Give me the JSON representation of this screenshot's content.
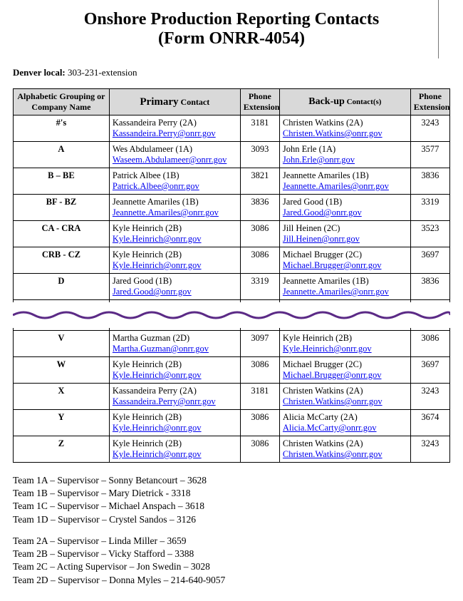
{
  "title_line1": "Onshore Production Reporting Contacts",
  "title_line2": "(Form ONRR-4054)",
  "denver_label": "Denver local:",
  "denver_value": "303-231-extension",
  "headers": {
    "group": "Alphabetic Grouping or Company Name",
    "primary_big": "Primary",
    "primary_sm": " Contact",
    "ext": "Phone Extension",
    "backup_big": "Back-up",
    "backup_sm": " Contact(s)"
  },
  "rows_top": [
    {
      "g": "#'s",
      "p_name": "Kassandeira Perry (2A)",
      "p_mail": "Kassandeira.Perry@onrr.gov",
      "p_ext": "3181",
      "b_name": "Christen Watkins (2A)",
      "b_mail": "Christen.Watkins@onrr.gov",
      "b_ext": "3243"
    },
    {
      "g": "A",
      "p_name": "Wes Abdulameer (1A)",
      "p_mail": "Waseem.Abdulameer@onrr.gov",
      "p_ext": "3093",
      "b_name": "John Erle (1A)",
      "b_mail": "John.Erle@onrr.gov",
      "b_ext": "3577"
    },
    {
      "g": "B – BE",
      "p_name": "Patrick Albee (1B)",
      "p_mail": "Patrick.Albee@onrr.gov",
      "p_ext": "3821",
      "b_name": "Jeannette Amariles (1B)",
      "b_mail": "Jeannette.Amariles@onrr.gov",
      "b_ext": "3836"
    },
    {
      "g": "BF - BZ",
      "p_name": "Jeannette Amariles (1B)",
      "p_mail": "Jeannette.Amariles@onrr.gov",
      "p_ext": "3836",
      "b_name": "Jared Good (1B)",
      "b_mail": "Jared.Good@onrr.gov",
      "b_ext": "3319"
    },
    {
      "g": "CA - CRA",
      "p_name": "Kyle Heinrich (2B)",
      "p_mail": "Kyle.Heinrich@onrr.gov",
      "p_ext": "3086",
      "b_name": "Jill Heinen (2C)",
      "b_mail": "Jill.Heinen@onrr.gov",
      "b_ext": "3523"
    },
    {
      "g": "CRB - CZ",
      "p_name": "Kyle Heinrich (2B)",
      "p_mail": "Kyle.Heinrich@onrr.gov",
      "p_ext": "3086",
      "b_name": "Michael Brugger (2C)",
      "b_mail": "Michael.Brugger@onrr.gov",
      "b_ext": "3697"
    },
    {
      "g": "D",
      "p_name": "Jared Good (1B)",
      "p_mail": "Jared.Good@onrr.gov",
      "p_ext": "3319",
      "b_name": "Jeannette Amariles (1B)",
      "b_mail": "Jeannette.Amariles@onrr.gov",
      "b_ext": "3836"
    }
  ],
  "rows_bottom": [
    {
      "g": "V",
      "p_name": "Martha Guzman (2D)",
      "p_mail": "Martha.Guzman@onrr.gov",
      "p_ext": "3097",
      "b_name": "Kyle Heinrich (2B)",
      "b_mail": "Kyle.Heinrich@onrr.gov",
      "b_ext": "3086"
    },
    {
      "g": "W",
      "p_name": "Kyle Heinrich (2B)",
      "p_mail": "Kyle.Heinrich@onrr.gov",
      "p_ext": "3086",
      "b_name": "Michael Brugger (2C)",
      "b_mail": "Michael.Brugger@onrr.gov",
      "b_ext": "3697"
    },
    {
      "g": "X",
      "p_name": "Kassandeira Perry (2A)",
      "p_mail": "Kassandeira.Perry@onrr.gov",
      "p_ext": "3181",
      "b_name": "Christen Watkins (2A)",
      "b_mail": "Christen.Watkins@onrr.gov",
      "b_ext": "3243"
    },
    {
      "g": "Y",
      "p_name": "Kyle Heinrich (2B)",
      "p_mail": "Kyle.Heinrich@onrr.gov",
      "p_ext": "3086",
      "b_name": "Alicia McCarty (2A)",
      "b_mail": "Alicia.McCarty@onrr.gov",
      "b_ext": "3674"
    },
    {
      "g": "Z",
      "p_name": "Kyle Heinrich (2B)",
      "p_mail": "Kyle.Heinrich@onrr.gov",
      "p_ext": "3086",
      "b_name": "Christen Watkins (2A)",
      "b_mail": "Christen.Watkins@onrr.gov",
      "b_ext": "3243"
    }
  ],
  "teams_block1": [
    "Team 1A – Supervisor – Sonny Betancourt – 3628",
    "Team 1B – Supervisor – Mary Dietrick - 3318",
    "Team 1C – Supervisor – Michael Anspach – 3618",
    "Team 1D – Supervisor – Crystel Sandos – 3126"
  ],
  "teams_block2": [
    "Team 2A – Supervisor – Linda Miller – 3659",
    "Team 2B – Supervisor – Vicky Stafford – 3388",
    "Team 2C – Acting Supervisor – Jon Swedin – 3028",
    "Team 2D – Supervisor – Donna Myles – 214-640-9057"
  ]
}
